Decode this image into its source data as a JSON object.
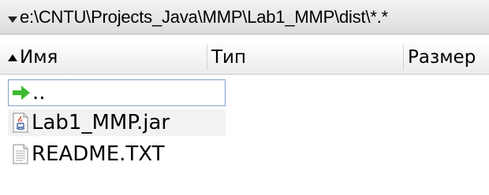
{
  "pathbar": {
    "path": "e:\\CNTU\\Projects_Java\\MMP\\Lab1_MMP\\dist\\*.*"
  },
  "columns": {
    "name": "Имя",
    "type": "Тип",
    "size": "Размер"
  },
  "files": [
    {
      "name": "..",
      "icon": "up-arrow-icon"
    },
    {
      "name": "Lab1_MMP.jar",
      "icon": "java-jar-icon"
    },
    {
      "name": "README.TXT",
      "icon": "text-file-icon"
    }
  ],
  "colors": {
    "focus_border": "#7da2ce",
    "up_arrow": "#3dbb2f",
    "row_highlight": "#f2f2f2"
  }
}
